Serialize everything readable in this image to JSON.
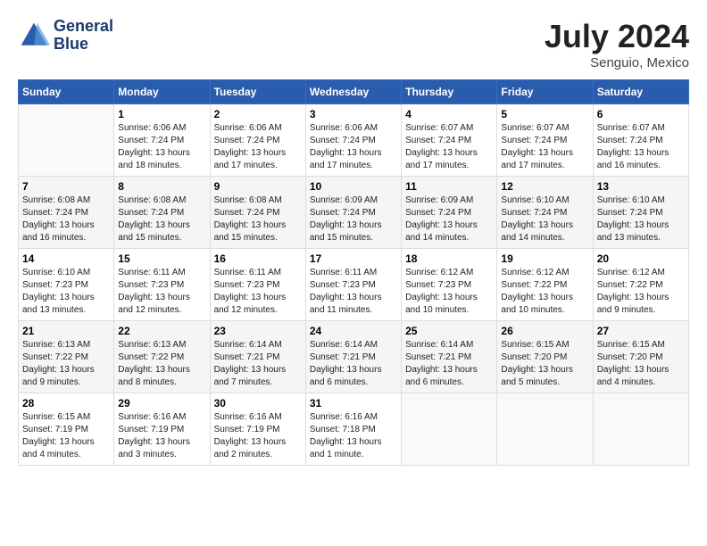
{
  "logo": {
    "line1": "General",
    "line2": "Blue"
  },
  "title": "July 2024",
  "location": "Senguio, Mexico",
  "days_header": [
    "Sunday",
    "Monday",
    "Tuesday",
    "Wednesday",
    "Thursday",
    "Friday",
    "Saturday"
  ],
  "weeks": [
    [
      {
        "num": "",
        "sunrise": "",
        "sunset": "",
        "daylight": ""
      },
      {
        "num": "1",
        "sunrise": "Sunrise: 6:06 AM",
        "sunset": "Sunset: 7:24 PM",
        "daylight": "Daylight: 13 hours and 18 minutes."
      },
      {
        "num": "2",
        "sunrise": "Sunrise: 6:06 AM",
        "sunset": "Sunset: 7:24 PM",
        "daylight": "Daylight: 13 hours and 17 minutes."
      },
      {
        "num": "3",
        "sunrise": "Sunrise: 6:06 AM",
        "sunset": "Sunset: 7:24 PM",
        "daylight": "Daylight: 13 hours and 17 minutes."
      },
      {
        "num": "4",
        "sunrise": "Sunrise: 6:07 AM",
        "sunset": "Sunset: 7:24 PM",
        "daylight": "Daylight: 13 hours and 17 minutes."
      },
      {
        "num": "5",
        "sunrise": "Sunrise: 6:07 AM",
        "sunset": "Sunset: 7:24 PM",
        "daylight": "Daylight: 13 hours and 17 minutes."
      },
      {
        "num": "6",
        "sunrise": "Sunrise: 6:07 AM",
        "sunset": "Sunset: 7:24 PM",
        "daylight": "Daylight: 13 hours and 16 minutes."
      }
    ],
    [
      {
        "num": "7",
        "sunrise": "Sunrise: 6:08 AM",
        "sunset": "Sunset: 7:24 PM",
        "daylight": "Daylight: 13 hours and 16 minutes."
      },
      {
        "num": "8",
        "sunrise": "Sunrise: 6:08 AM",
        "sunset": "Sunset: 7:24 PM",
        "daylight": "Daylight: 13 hours and 15 minutes."
      },
      {
        "num": "9",
        "sunrise": "Sunrise: 6:08 AM",
        "sunset": "Sunset: 7:24 PM",
        "daylight": "Daylight: 13 hours and 15 minutes."
      },
      {
        "num": "10",
        "sunrise": "Sunrise: 6:09 AM",
        "sunset": "Sunset: 7:24 PM",
        "daylight": "Daylight: 13 hours and 15 minutes."
      },
      {
        "num": "11",
        "sunrise": "Sunrise: 6:09 AM",
        "sunset": "Sunset: 7:24 PM",
        "daylight": "Daylight: 13 hours and 14 minutes."
      },
      {
        "num": "12",
        "sunrise": "Sunrise: 6:10 AM",
        "sunset": "Sunset: 7:24 PM",
        "daylight": "Daylight: 13 hours and 14 minutes."
      },
      {
        "num": "13",
        "sunrise": "Sunrise: 6:10 AM",
        "sunset": "Sunset: 7:24 PM",
        "daylight": "Daylight: 13 hours and 13 minutes."
      }
    ],
    [
      {
        "num": "14",
        "sunrise": "Sunrise: 6:10 AM",
        "sunset": "Sunset: 7:23 PM",
        "daylight": "Daylight: 13 hours and 13 minutes."
      },
      {
        "num": "15",
        "sunrise": "Sunrise: 6:11 AM",
        "sunset": "Sunset: 7:23 PM",
        "daylight": "Daylight: 13 hours and 12 minutes."
      },
      {
        "num": "16",
        "sunrise": "Sunrise: 6:11 AM",
        "sunset": "Sunset: 7:23 PM",
        "daylight": "Daylight: 13 hours and 12 minutes."
      },
      {
        "num": "17",
        "sunrise": "Sunrise: 6:11 AM",
        "sunset": "Sunset: 7:23 PM",
        "daylight": "Daylight: 13 hours and 11 minutes."
      },
      {
        "num": "18",
        "sunrise": "Sunrise: 6:12 AM",
        "sunset": "Sunset: 7:23 PM",
        "daylight": "Daylight: 13 hours and 10 minutes."
      },
      {
        "num": "19",
        "sunrise": "Sunrise: 6:12 AM",
        "sunset": "Sunset: 7:22 PM",
        "daylight": "Daylight: 13 hours and 10 minutes."
      },
      {
        "num": "20",
        "sunrise": "Sunrise: 6:12 AM",
        "sunset": "Sunset: 7:22 PM",
        "daylight": "Daylight: 13 hours and 9 minutes."
      }
    ],
    [
      {
        "num": "21",
        "sunrise": "Sunrise: 6:13 AM",
        "sunset": "Sunset: 7:22 PM",
        "daylight": "Daylight: 13 hours and 9 minutes."
      },
      {
        "num": "22",
        "sunrise": "Sunrise: 6:13 AM",
        "sunset": "Sunset: 7:22 PM",
        "daylight": "Daylight: 13 hours and 8 minutes."
      },
      {
        "num": "23",
        "sunrise": "Sunrise: 6:14 AM",
        "sunset": "Sunset: 7:21 PM",
        "daylight": "Daylight: 13 hours and 7 minutes."
      },
      {
        "num": "24",
        "sunrise": "Sunrise: 6:14 AM",
        "sunset": "Sunset: 7:21 PM",
        "daylight": "Daylight: 13 hours and 6 minutes."
      },
      {
        "num": "25",
        "sunrise": "Sunrise: 6:14 AM",
        "sunset": "Sunset: 7:21 PM",
        "daylight": "Daylight: 13 hours and 6 minutes."
      },
      {
        "num": "26",
        "sunrise": "Sunrise: 6:15 AM",
        "sunset": "Sunset: 7:20 PM",
        "daylight": "Daylight: 13 hours and 5 minutes."
      },
      {
        "num": "27",
        "sunrise": "Sunrise: 6:15 AM",
        "sunset": "Sunset: 7:20 PM",
        "daylight": "Daylight: 13 hours and 4 minutes."
      }
    ],
    [
      {
        "num": "28",
        "sunrise": "Sunrise: 6:15 AM",
        "sunset": "Sunset: 7:19 PM",
        "daylight": "Daylight: 13 hours and 4 minutes."
      },
      {
        "num": "29",
        "sunrise": "Sunrise: 6:16 AM",
        "sunset": "Sunset: 7:19 PM",
        "daylight": "Daylight: 13 hours and 3 minutes."
      },
      {
        "num": "30",
        "sunrise": "Sunrise: 6:16 AM",
        "sunset": "Sunset: 7:19 PM",
        "daylight": "Daylight: 13 hours and 2 minutes."
      },
      {
        "num": "31",
        "sunrise": "Sunrise: 6:16 AM",
        "sunset": "Sunset: 7:18 PM",
        "daylight": "Daylight: 13 hours and 1 minute."
      },
      {
        "num": "",
        "sunrise": "",
        "sunset": "",
        "daylight": ""
      },
      {
        "num": "",
        "sunrise": "",
        "sunset": "",
        "daylight": ""
      },
      {
        "num": "",
        "sunrise": "",
        "sunset": "",
        "daylight": ""
      }
    ]
  ]
}
